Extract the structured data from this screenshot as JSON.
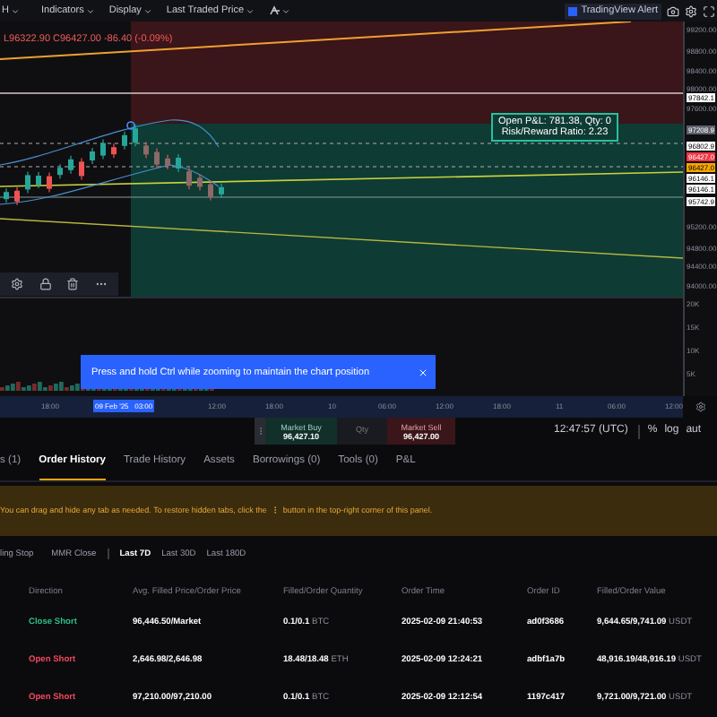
{
  "toolbar": {
    "items": [
      "H",
      "Indicators",
      "Display",
      "Last Traded Price"
    ],
    "alert_button": "TradingView Alert"
  },
  "chart": {
    "legend": "L96322.90 C96427.00 -86.40 (-0.09%)",
    "position_tooltip": [
      "Open P&L: 781.38, Qty: 0",
      "Risk/Reward Ratio: 2.23"
    ],
    "price_axis": [
      {
        "text": "99200.00",
        "kind": "plain"
      },
      {
        "text": "98800.00",
        "kind": "plain"
      },
      {
        "text": "98400.00",
        "kind": "plain"
      },
      {
        "text": "98000.00",
        "kind": "plain"
      },
      {
        "text": "97842.1",
        "kind": "boxed"
      },
      {
        "text": "97600.00",
        "kind": "plain"
      },
      {
        "text": "97208.9",
        "kind": "grey"
      },
      {
        "text": "96802.9",
        "kind": "boxed"
      },
      {
        "text": "96427.0",
        "kind": "red"
      },
      {
        "text": "96427.0",
        "kind": "orange"
      },
      {
        "text": "96146.1",
        "kind": "boxed"
      },
      {
        "text": "96146.1",
        "kind": "boxed"
      },
      {
        "text": "95742.9",
        "kind": "boxed"
      },
      {
        "text": "95200.00",
        "kind": "plain"
      },
      {
        "text": "94800.00",
        "kind": "plain"
      },
      {
        "text": "94400.00",
        "kind": "plain"
      },
      {
        "text": "94000.00",
        "kind": "plain"
      },
      {
        "text": "20K",
        "kind": "plain"
      },
      {
        "text": "15K",
        "kind": "plain"
      },
      {
        "text": "10K",
        "kind": "plain"
      },
      {
        "text": "5K",
        "kind": "plain"
      }
    ],
    "time_axis": [
      {
        "text": "18:00",
        "selected": false
      },
      {
        "text": "09 Feb '25   03:00",
        "selected": true
      },
      {
        "text": "12:00",
        "selected": false
      },
      {
        "text": "18:00",
        "selected": false
      },
      {
        "text": "10",
        "selected": false
      },
      {
        "text": "06:00",
        "selected": false
      },
      {
        "text": "12:00",
        "selected": false
      },
      {
        "text": "18:00",
        "selected": false
      },
      {
        "text": "11",
        "selected": false
      },
      {
        "text": "06:00",
        "selected": false
      },
      {
        "text": "12:00",
        "selected": false
      }
    ],
    "hint": "Press and hold Ctrl while zooming to maintain the chart position"
  },
  "order_bar": {
    "buy_label": "Market Buy",
    "buy_price": "96,427.10",
    "qty_placeholder": "Qty",
    "sell_label": "Market Sell",
    "sell_price": "96,427.00",
    "clock": "12:47:57 (UTC)",
    "scale_options": [
      "%",
      "log",
      "aut"
    ]
  },
  "tabs": [
    {
      "label": "s (1)",
      "selected": false
    },
    {
      "label": "Order History",
      "selected": true
    },
    {
      "label": "Trade History",
      "selected": false
    },
    {
      "label": "Assets",
      "selected": false
    },
    {
      "label": "Borrowings (0)",
      "selected": false
    },
    {
      "label": "Tools (0)",
      "selected": false
    },
    {
      "label": "P&L",
      "selected": false
    }
  ],
  "notice": {
    "before": "You can drag and hide any tab as needed. To restore hidden tabs, click the",
    "after": "button in the top-right corner of this panel."
  },
  "order_types": [
    {
      "label": "ling Stop",
      "selected": false
    },
    {
      "label": "MMR Close",
      "selected": false
    }
  ],
  "periods": [
    {
      "label": "Last 7D",
      "selected": true
    },
    {
      "label": "Last 30D",
      "selected": false
    },
    {
      "label": "Last 180D",
      "selected": false
    }
  ],
  "table": {
    "columns": [
      "Direction",
      "Avg. Filled Price/Order Price",
      "Filled/Order Quantity",
      "Order Time",
      "Order ID",
      "Filled/Order Value"
    ],
    "rows": [
      {
        "direction": "Close Short",
        "color": "#2ebd85",
        "price": "96,446.50/Market",
        "quantity": "0.1/0.1",
        "asset": "BTC",
        "time": "2025-02-09 21:40:53",
        "order_id": "ad0f3686",
        "value": "9,644.65/9,741.09",
        "currency": "USDT"
      },
      {
        "direction": "Open Short",
        "color": "#f6465d",
        "price": "2,646.98/2,646.98",
        "quantity": "18.48/18.48",
        "asset": "ETH",
        "time": "2025-02-09 12:24:21",
        "order_id": "adbf1a7b",
        "value": "48,916.19/48,916.19",
        "currency": "USDT"
      },
      {
        "direction": "Open Short",
        "color": "#f6465d",
        "price": "97,210.00/97,210.00",
        "quantity": "0.1/0.1",
        "asset": "BTC",
        "time": "2025-02-09 12:12:54",
        "order_id": "1197c417",
        "value": "9,721.00/9,721.00",
        "currency": "USDT"
      }
    ]
  }
}
